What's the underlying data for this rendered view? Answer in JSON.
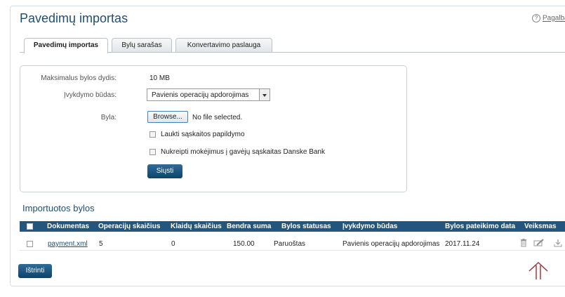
{
  "page": {
    "title": "Pavedimų importas",
    "help_label": "Pagalba"
  },
  "tabs": [
    {
      "label": "Pavedimų importas",
      "active": true
    },
    {
      "label": "Bylų sarašas",
      "active": false
    },
    {
      "label": "Konvertavimo paslauga",
      "active": false
    }
  ],
  "form": {
    "max_size_label": "Maksimalus bylos dydis:",
    "max_size_value": "10 MB",
    "method_label": "Įvykdymo būdas:",
    "method_value": "Pavienis operacijų apdorojimas",
    "file_label": "Byla:",
    "browse_label": "Browse...",
    "no_file_text": "No file selected.",
    "wait_label": "Laukti sąskaitos papildymo",
    "redirect_label": "Nukreipti mokėjimus į gavėjų sąskaitas Danske Bank",
    "send_label": "Siųsti"
  },
  "imported": {
    "title": "Importuotos bylos",
    "columns": [
      "Dokumentas",
      "Operacijų skaičius",
      "Klaidų skaičius",
      "Bendra suma",
      "Bylos statusas",
      "Įvykdymo būdas",
      "Bylos pateikimo data",
      "Veiksmas"
    ],
    "rows": [
      {
        "document": "payment.xml",
        "operations": "5",
        "errors": "0",
        "total": "150.00",
        "status": "Paruoštas",
        "method": "Pavienis operacijų apdorojimas",
        "date": "2017.11.24"
      }
    ],
    "delete_label": "Ištrinti",
    "action_icons": [
      "trash-icon",
      "edit-icon",
      "download-icon"
    ]
  },
  "colors": {
    "accent": "#1d4f73",
    "header_bg": "#22567f",
    "button": "#0e4268",
    "indicator": "#c0392b"
  }
}
